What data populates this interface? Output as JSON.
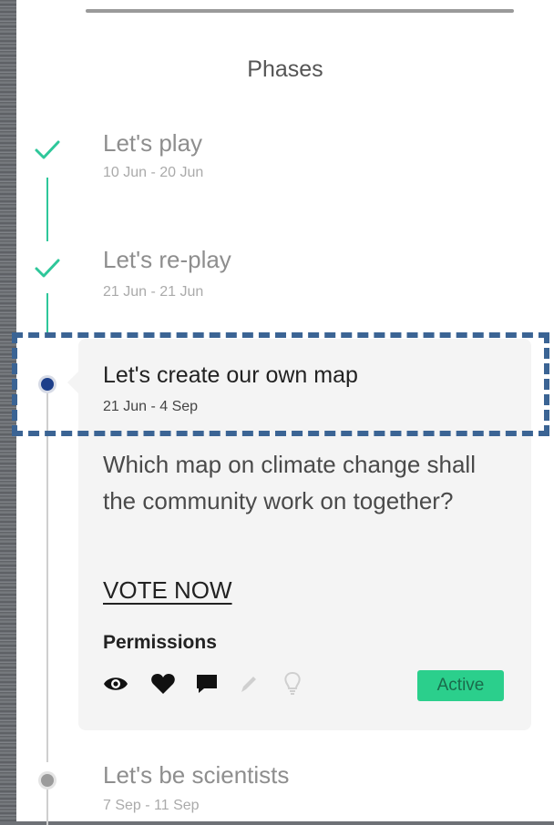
{
  "panel": {
    "title": "Phases"
  },
  "phases": [
    {
      "name": "Let's play",
      "dates": "10 Jun - 20 Jun",
      "status": "completed"
    },
    {
      "name": "Let's re-play",
      "dates": "21 Jun - 21 Jun",
      "status": "completed"
    },
    {
      "name": "Let's create our own map",
      "dates": "21 Jun - 4 Sep",
      "status": "current",
      "description": "Which map on climate change shall the community work on together?",
      "action_label": "VOTE NOW",
      "permissions_label": "Permissions",
      "permissions": [
        {
          "icon": "eye-icon",
          "enabled": true
        },
        {
          "icon": "heart-icon",
          "enabled": true
        },
        {
          "icon": "comment-icon",
          "enabled": true
        },
        {
          "icon": "pencil-icon",
          "enabled": false
        },
        {
          "icon": "lightbulb-icon",
          "enabled": false
        }
      ],
      "badge": "Active"
    },
    {
      "name": "Let's be scientists",
      "dates": "7 Sep - 11 Sep",
      "status": "upcoming"
    }
  ],
  "colors": {
    "completed": "#2ec79a",
    "current": "#1d3f8a",
    "badge": "#2bcf8c",
    "highlight": "#3b6494"
  }
}
